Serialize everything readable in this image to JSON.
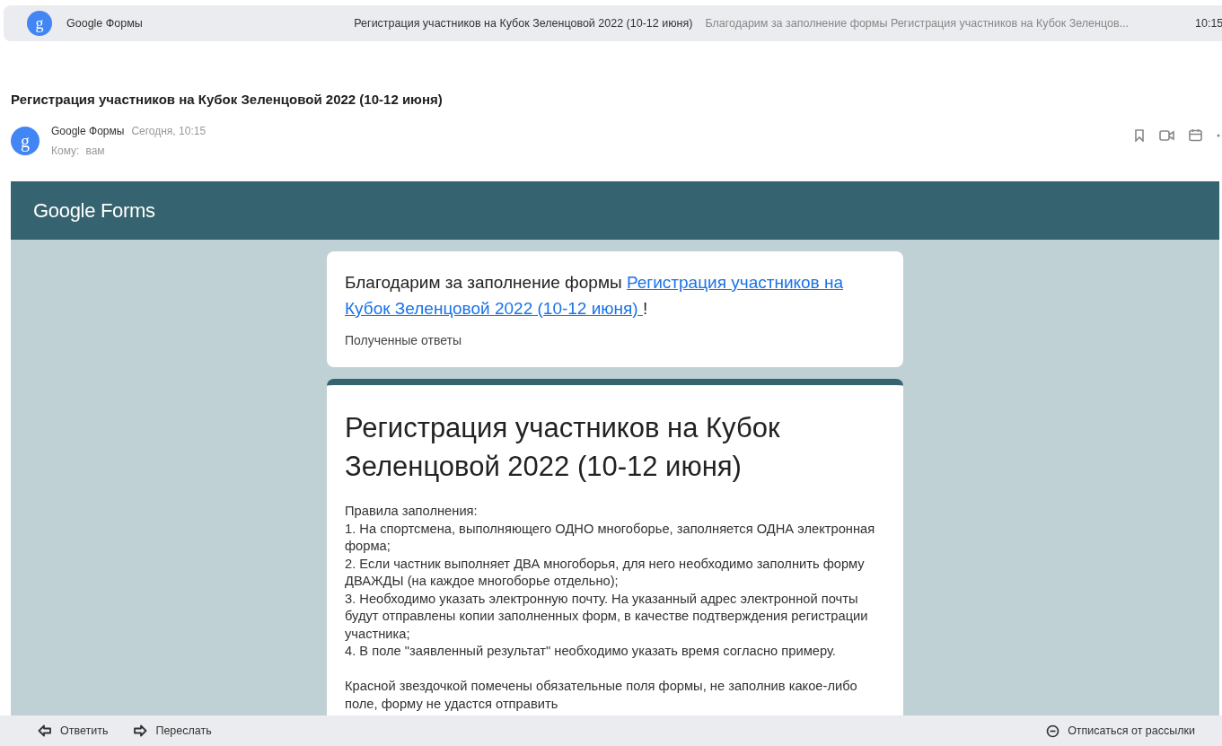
{
  "list_row": {
    "avatar_letter": "g",
    "sender": "Google Формы",
    "subject": "Регистрация участников на Кубок Зеленцовой 2022 (10-12 июня)",
    "snippet": "Благодарим за заполнение формы Регистрация участников на Кубок Зеленцов...",
    "time": "10:15"
  },
  "message": {
    "avatar_letter": "g",
    "subject": "Регистрация участников на Кубок Зеленцовой 2022 (10-12 июня)",
    "sender": "Google Формы",
    "date": "Сегодня, 10:15",
    "to_label": "Кому:",
    "to": "вам"
  },
  "banner": {
    "logo_google": "Google",
    "logo_forms": "Forms"
  },
  "thanks_card": {
    "text": "Благодарим за заполнение формы ",
    "link_lines": [
      "Регистрация участников на ",
      "Кубок Зеленцовой 2022 (10-12 июня) "
    ],
    "after": "!",
    "subtitle": "Полученные ответы"
  },
  "form_card": {
    "title": "Регистрация участников на Кубок Зеленцовой 2022 (10-12 июня)",
    "lines": [
      "Правила заполнения:",
      "1. На спортсмена, выполняющего ОДНО многоборье, заполняется ОДНА электронная форма;",
      "2. Если частник выполняет ДВА многоборья, для него необходимо заполнить форму ДВАЖДЫ (на каждое многоборье отдельно);",
      "3. Необходимо указать электронную почту. На указанный адрес электронной почты будут отправлены копии заполненных форм, в качестве подтверждения регистрации участника;",
      "4. В поле \"заявленный результат\" необходимо указать время согласно примеру."
    ],
    "note": "Красной звездочкой помечены обязательные поля формы, не заполнив какое-либо поле, форму не удастся отправить"
  },
  "footer": {
    "reply": "Ответить",
    "forward": "Переслать",
    "unsubscribe": "Отписаться от рассылки"
  }
}
